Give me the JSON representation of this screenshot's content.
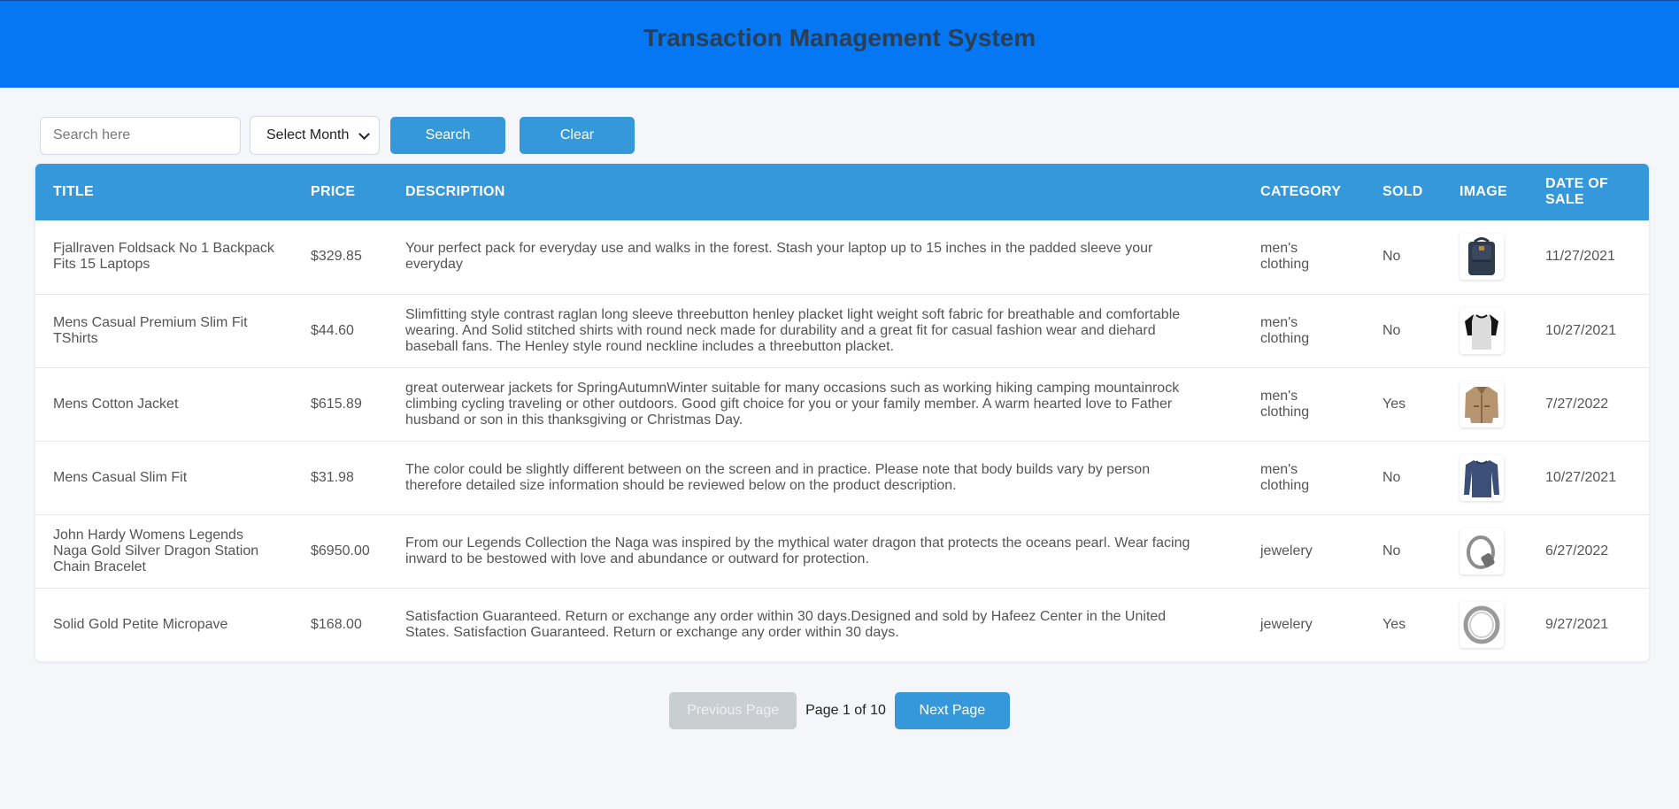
{
  "header": {
    "title": "Transaction Management System"
  },
  "search": {
    "placeholder": "Search here",
    "value": ""
  },
  "month_select": {
    "selected": "Select Month"
  },
  "buttons": {
    "search": "Search",
    "clear": "Clear"
  },
  "table": {
    "columns": {
      "title": "TITLE",
      "price": "PRICE",
      "description": "DESCRIPTION",
      "category": "CATEGORY",
      "sold": "SOLD",
      "image": "IMAGE",
      "date": "DATE OF SALE"
    },
    "rows": [
      {
        "title": "Fjallraven Foldsack No 1 Backpack Fits 15 Laptops",
        "price": "$329.85",
        "description": "Your perfect pack for everyday use and walks in the forest. Stash your laptop up to 15 inches in the padded sleeve your everyday",
        "category": "men's clothing",
        "sold": "No",
        "image_icon": "backpack-image",
        "date": "11/27/2021"
      },
      {
        "title": "Mens Casual Premium Slim Fit TShirts",
        "price": "$44.60",
        "description": "Slimfitting style contrast raglan long sleeve threebutton henley placket light weight soft fabric for breathable and comfortable wearing. And Solid stitched shirts with round neck made for durability and a great fit for casual fashion wear and diehard baseball fans. The Henley style round neckline includes a threebutton placket.",
        "category": "men's clothing",
        "sold": "No",
        "image_icon": "tshirt-image",
        "date": "10/27/2021"
      },
      {
        "title": "Mens Cotton Jacket",
        "price": "$615.89",
        "description": "great outerwear jackets for SpringAutumnWinter suitable for many occasions such as working hiking camping mountainrock climbing cycling traveling or other outdoors. Good gift choice for you or your family member. A warm hearted love to Father husband or son in this thanksgiving or Christmas Day.",
        "category": "men's clothing",
        "sold": "Yes",
        "image_icon": "jacket-image",
        "date": "7/27/2022"
      },
      {
        "title": "Mens Casual Slim Fit",
        "price": "$31.98",
        "description": "The color could be slightly different between on the screen and in practice. Please note that body builds vary by person therefore detailed size information should be reviewed below on the product description.",
        "category": "men's clothing",
        "sold": "No",
        "image_icon": "longsleeve-image",
        "date": "10/27/2021"
      },
      {
        "title": "John Hardy Womens Legends Naga Gold Silver Dragon Station Chain Bracelet",
        "price": "$6950.00",
        "description": "From our Legends Collection the Naga was inspired by the mythical water dragon that protects the oceans pearl. Wear facing inward to be bestowed with love and abundance or outward for protection.",
        "category": "jewelery",
        "sold": "No",
        "image_icon": "bracelet-image",
        "date": "6/27/2022"
      },
      {
        "title": "Solid Gold Petite Micropave",
        "price": "$168.00",
        "description": "Satisfaction Guaranteed. Return or exchange any order within 30 days.Designed and sold by Hafeez Center in the United States. Satisfaction Guaranteed. Return or exchange any order within 30 days.",
        "category": "jewelery",
        "sold": "Yes",
        "image_icon": "ring-image",
        "date": "9/27/2021"
      }
    ]
  },
  "pagination": {
    "prev_label": "Previous Page",
    "page_info": "Page 1 of 10",
    "next_label": "Next Page"
  },
  "colors": {
    "header_bg": "#0577f2",
    "accent": "#3498db",
    "disabled": "#c9ced3"
  }
}
